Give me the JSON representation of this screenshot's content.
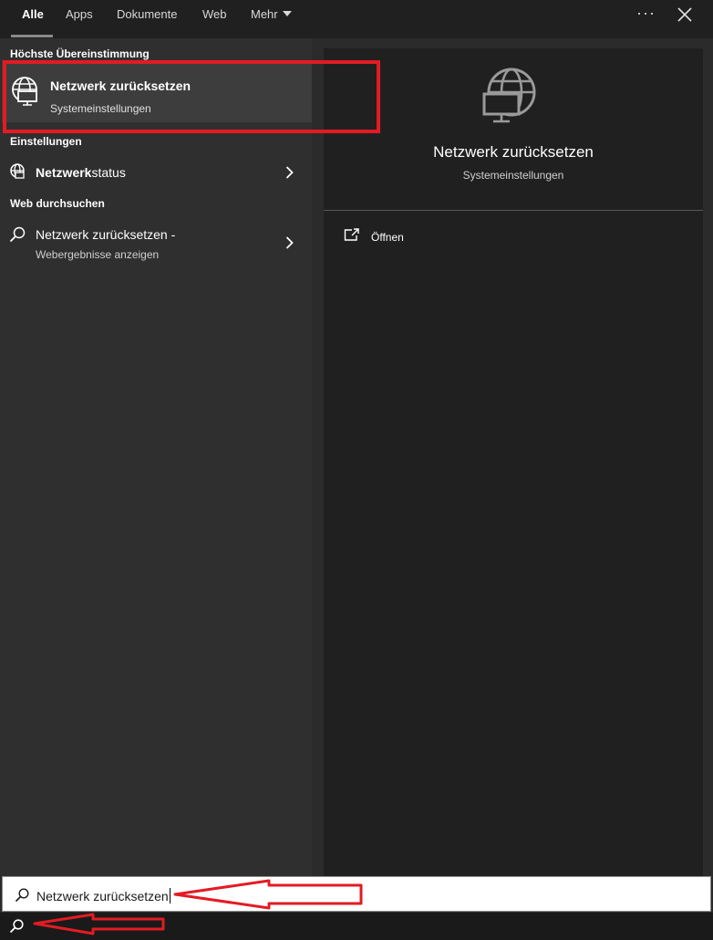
{
  "tabs": [
    {
      "label": "Alle",
      "active": true
    },
    {
      "label": "Apps"
    },
    {
      "label": "Dokumente"
    },
    {
      "label": "Web"
    },
    {
      "label": "Mehr"
    }
  ],
  "window_controls": {
    "more": "···",
    "close_icon": "close-icon"
  },
  "left": {
    "best_match_header": "Höchste Übereinstimmung",
    "best_match": {
      "title": "Netzwerk zurücksetzen",
      "subtitle": "Systemeinstellungen",
      "icon": "globe-monitor-icon"
    },
    "settings_header": "Einstellungen",
    "settings_item": {
      "label_bold": "Netzwerk",
      "label_rest": "status",
      "icon": "network-icon"
    },
    "web_header": "Web durchsuchen",
    "web_item": {
      "label": "Netzwerk zurücksetzen -",
      "sublabel": "Webergebnisse anzeigen",
      "icon": "search-icon"
    }
  },
  "right": {
    "title": "Netzwerk zurücksetzen",
    "subtitle": "Systemeinstellungen",
    "action_open": "Öffnen"
  },
  "search": {
    "query": "Netzwerk zurücksetzen"
  },
  "colors": {
    "annotation_red": "#e31b23",
    "left_panel": "#2f2f2f",
    "right_panel": "#202020",
    "top_bar": "#202020"
  }
}
